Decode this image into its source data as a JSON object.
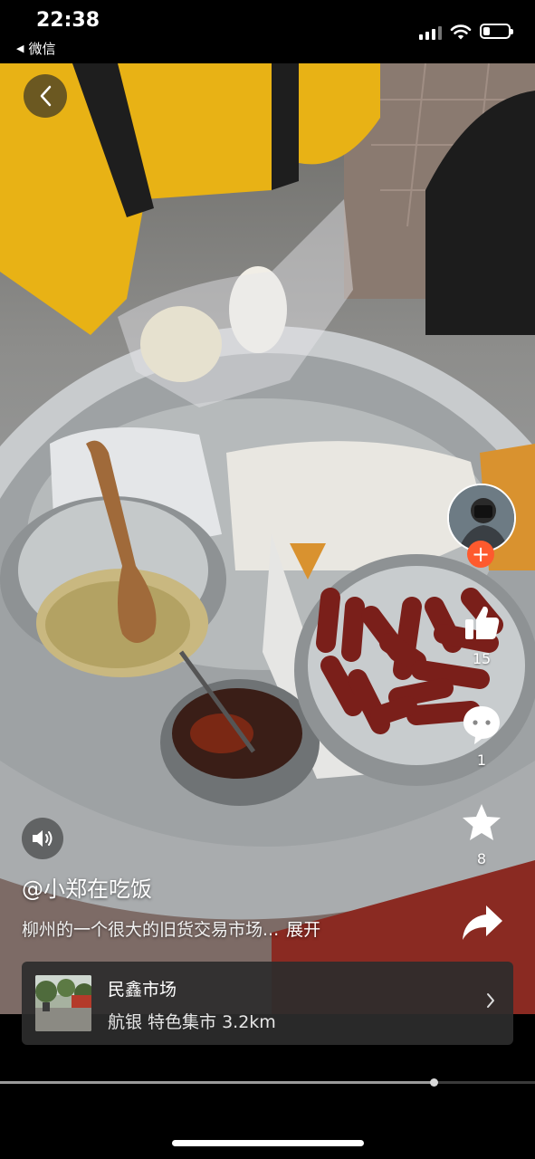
{
  "status_bar": {
    "time": "22:38",
    "back_app_label": "微信",
    "battery_level": 0.25
  },
  "author": {
    "name": "@小郑在吃饭"
  },
  "description": {
    "text": "柳州的一个很大的旧货交易市场...",
    "expand_label": "展开"
  },
  "actions": {
    "like": {
      "icon": "thumbs-up-icon",
      "count": "15"
    },
    "comment": {
      "icon": "comment-bubble-icon",
      "count": "1"
    },
    "favorite": {
      "icon": "star-icon",
      "count": "8"
    },
    "share": {
      "icon": "share-arrow-icon"
    }
  },
  "follow": {
    "icon": "plus-icon",
    "color": "#fe5a2e"
  },
  "location": {
    "name": "民鑫市场",
    "subtitle": "航银 特色集市 3.2km"
  },
  "playback": {
    "progress": 0.81
  },
  "colors": {
    "accent": "#fe5a2e",
    "card_bg": "#2d2d2d"
  }
}
